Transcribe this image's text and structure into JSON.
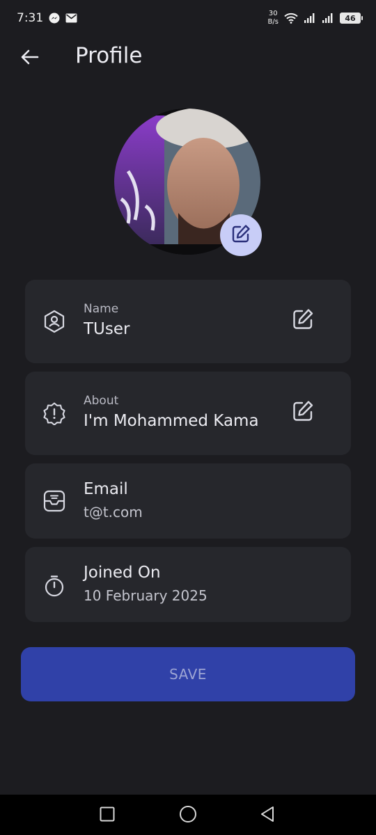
{
  "status_bar": {
    "time": "7:31",
    "net_speed_value": "30",
    "net_speed_unit": "B/s",
    "battery": "46",
    "icons": [
      "messenger-icon",
      "mail-icon",
      "wifi-icon",
      "signal-icon",
      "signal-icon",
      "battery-icon"
    ]
  },
  "header": {
    "title": "Profile",
    "back_icon": "back-arrow-icon"
  },
  "avatar": {
    "edit_icon": "pencil-square-icon"
  },
  "cards": {
    "name": {
      "label": "Name",
      "value": "TUser",
      "icon": "user-hexagon-icon"
    },
    "about": {
      "label": "About",
      "value": "I'm Mohammed Kamal",
      "icon": "alert-badge-icon"
    },
    "email": {
      "label": "Email",
      "value": "t@t.com",
      "icon": "inbox-icon"
    },
    "joined": {
      "label": "Joined On",
      "value": "10 February 2025",
      "icon": "stopwatch-icon"
    }
  },
  "save_button": {
    "label": "SAVE"
  },
  "nav_bar": {
    "icons": [
      "recents-square-icon",
      "home-circle-icon",
      "back-triangle-icon"
    ]
  },
  "colors": {
    "background": "#1c1c20",
    "card": "#26272c",
    "accent_button": "#3041a8",
    "avatar_edit_bg": "#c8cdf7"
  }
}
